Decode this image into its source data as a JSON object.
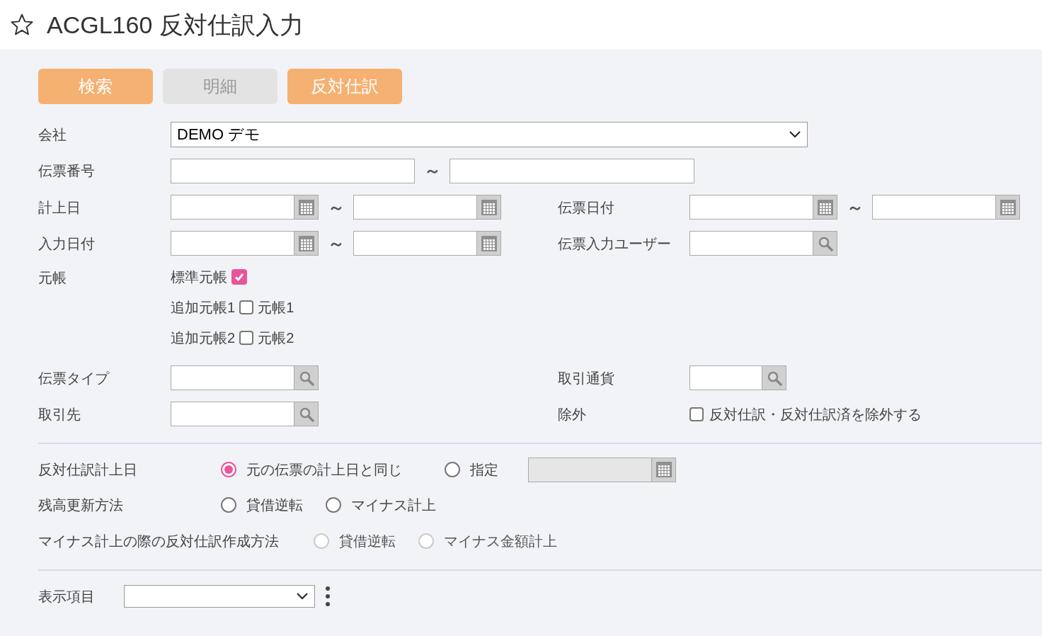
{
  "title": "ACGL160 反対仕訳入力",
  "buttons": [
    {
      "label": "検索",
      "disabled": false
    },
    {
      "label": "明細",
      "disabled": true
    },
    {
      "label": "反対仕訳",
      "disabled": false
    }
  ],
  "company": {
    "label": "会社",
    "value": "DEMO デモ"
  },
  "voucher_number": {
    "label": "伝票番号",
    "separator": "～"
  },
  "posting_date": {
    "label": "計上日",
    "separator": "～"
  },
  "voucher_date": {
    "label": "伝票日付",
    "separator": "～"
  },
  "input_date": {
    "label": "入力日付",
    "separator": "～"
  },
  "input_user": {
    "label": "伝票入力ユーザー"
  },
  "ledger": {
    "label": "元帳",
    "items": [
      {
        "label": "標準元帳",
        "checked": true
      },
      {
        "label": "追加元帳1",
        "checked": false,
        "suffix": "元帳1"
      },
      {
        "label": "追加元帳2",
        "checked": false,
        "suffix": "元帳2"
      }
    ]
  },
  "voucher_type": {
    "label": "伝票タイプ"
  },
  "currency": {
    "label": "取引通貨"
  },
  "partner": {
    "label": "取引先"
  },
  "exclude": {
    "label": "除外",
    "option": "反対仕訳・反対仕訳済を除外する",
    "checked": false
  },
  "reverse_date": {
    "label": "反対仕訳計上日",
    "options": [
      {
        "label": "元の伝票の計上日と同じ",
        "selected": true,
        "disabled": false
      },
      {
        "label": "指定",
        "selected": false,
        "disabled": false
      }
    ],
    "date_disabled": true
  },
  "balance_method": {
    "label": "残高更新方法",
    "options": [
      {
        "label": "貸借逆転",
        "selected": false,
        "disabled": false
      },
      {
        "label": "マイナス計上",
        "selected": false,
        "disabled": false
      }
    ]
  },
  "minus_method": {
    "label": "マイナス計上の際の反対仕訳作成方法",
    "options": [
      {
        "label": "貸借逆転",
        "selected": false,
        "disabled": true
      },
      {
        "label": "マイナス金額計上",
        "selected": false,
        "disabled": true
      }
    ]
  },
  "display_items": {
    "label": "表示項目"
  }
}
